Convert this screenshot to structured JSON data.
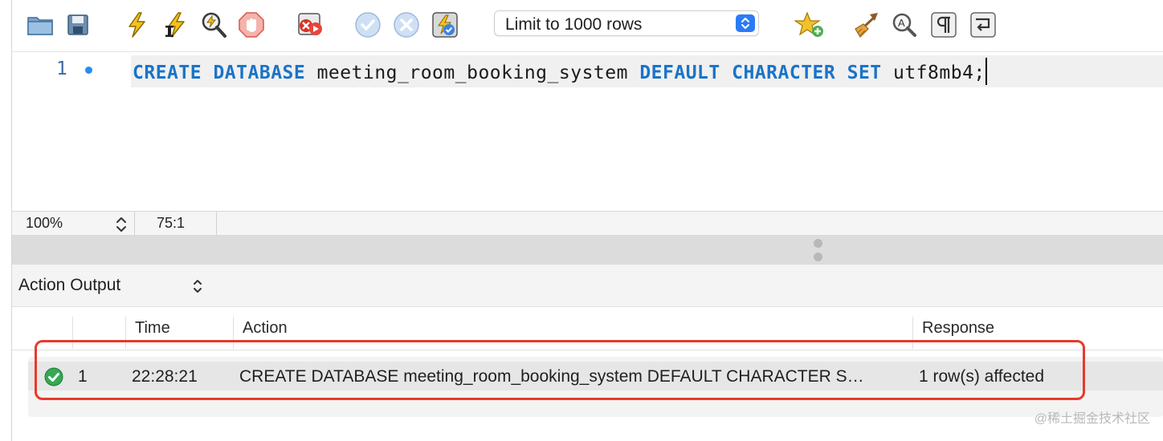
{
  "toolbar": {
    "limit_label": "Limit to 1000 rows",
    "icons": [
      "open-folder-icon",
      "save-icon",
      "execute-icon",
      "execute-current-icon",
      "explain-icon",
      "stop-icon",
      "toggle-error-stop-icon",
      "commit-icon",
      "rollback-icon",
      "autocommit-icon",
      "add-snippet-icon",
      "beautify-icon",
      "find-icon",
      "invisible-chars-icon",
      "wrap-lines-icon"
    ]
  },
  "editor": {
    "line_number": "1",
    "code_tokens": [
      {
        "text": "CREATE",
        "kw": true
      },
      {
        "text": " ",
        "kw": false
      },
      {
        "text": "DATABASE",
        "kw": true
      },
      {
        "text": " meeting_room_booking_system ",
        "kw": false
      },
      {
        "text": "DEFAULT",
        "kw": true
      },
      {
        "text": " ",
        "kw": false
      },
      {
        "text": "CHARACTER",
        "kw": true
      },
      {
        "text": " ",
        "kw": false
      },
      {
        "text": "SET",
        "kw": true
      },
      {
        "text": " utf8mb4;",
        "kw": false
      }
    ]
  },
  "status": {
    "zoom": "100%",
    "cursor_position": "75:1"
  },
  "output": {
    "selector_label": "Action Output",
    "columns": {
      "time": "Time",
      "action": "Action",
      "response": "Response"
    },
    "rows": [
      {
        "status": "success",
        "index": "1",
        "time": "22:28:21",
        "action": "CREATE DATABASE meeting_room_booking_system DEFAULT CHARACTER S…",
        "response": "1 row(s) affected"
      }
    ]
  },
  "colors": {
    "keyword": "#1a73c8",
    "highlight_border": "#e8392a",
    "success": "#34a853",
    "stepper": "#2a7cf6"
  },
  "watermark": "@稀土掘金技术社区"
}
